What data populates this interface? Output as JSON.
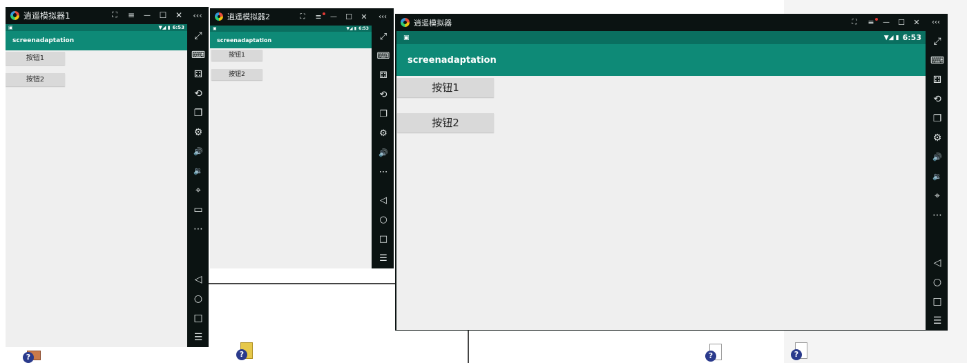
{
  "desktop": {
    "help_glyph": "?"
  },
  "emulators": [
    {
      "title": "逍遥模拟器1",
      "status_time": "6:53",
      "app_title": "screenadaptation",
      "buttons": [
        "按钮1",
        "按钮2"
      ]
    },
    {
      "title": "逍遥模拟器2",
      "status_time": "6:53",
      "app_title": "screenadaptation",
      "buttons": [
        "按钮1",
        "按钮2"
      ]
    },
    {
      "title": "逍遥模拟器",
      "status_time": "6:53",
      "app_title": "screenadaptation",
      "buttons": [
        "按钮1",
        "按钮2"
      ]
    }
  ],
  "controls": {
    "screenshot": "⛶",
    "menu": "≡",
    "minimize": "—",
    "maximize": "☐",
    "close": "✕",
    "collapse": "‹‹‹"
  },
  "sidebar": {
    "fullscreen": "⤢",
    "keyboard": "⌨",
    "macro": "⚃",
    "rotate": "⟲",
    "multi": "❐",
    "settings": "⚙",
    "vol_up": "🔊",
    "vol_down": "🔉",
    "location": "⌖",
    "folder": "▭",
    "more": "⋯",
    "back": "◁",
    "home": "○",
    "recent": "□",
    "list": "☰"
  },
  "status_icons": {
    "wifi": "▼◢ ▮"
  },
  "notify_icons": {
    "n1": "▣"
  }
}
